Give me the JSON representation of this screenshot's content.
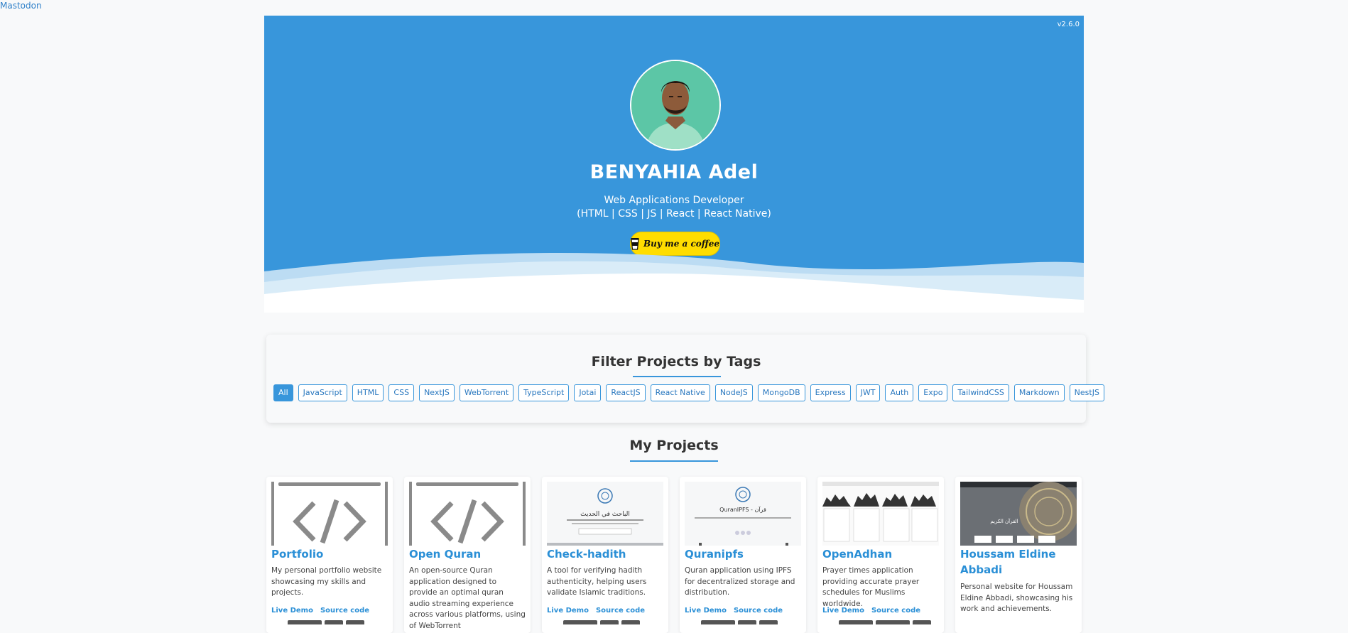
{
  "top_link": "Mastodon",
  "hero": {
    "version": "v2.6.0",
    "name": "BENYAHIA Adel",
    "role_line1": "Web Applications Developer",
    "role_line2": "(HTML | CSS | JS | React | React Native)",
    "coffee_label": "Buy me a coffee",
    "bg_color": "#3896db"
  },
  "filter": {
    "title": "Filter Projects by Tags",
    "tags": [
      "All",
      "JavaScript",
      "HTML",
      "CSS",
      "NextJS",
      "WebTorrent",
      "TypeScript",
      "Jotai",
      "ReactJS",
      "React Native",
      "NodeJS",
      "MongoDB",
      "Express",
      "JWT",
      "Auth",
      "Expo",
      "TailwindCSS",
      "Markdown",
      "NestJS"
    ],
    "active": "All"
  },
  "projects": {
    "title": "My Projects",
    "cards": [
      {
        "title": "Portfolio",
        "desc": "My personal portfolio website showcasing my skills and projects.",
        "live": "Live Demo",
        "source": "Source code",
        "thumb": "code-icon"
      },
      {
        "title": "Open Quran",
        "desc": "An open-source Quran application designed to provide an optimal quran audio streaming experience across various platforms, using of WebTorrent",
        "live": "Live Demo",
        "source": "Source code",
        "thumb": "code-icon"
      },
      {
        "title": "Check-hadith",
        "desc": "A tool for verifying hadith authenticity, helping users validate Islamic traditions.",
        "live": "Live Demo",
        "source": "Source code",
        "thumb": "screenshot-hadith",
        "thumb_text": "الباحث في الحديث"
      },
      {
        "title": "Quranipfs",
        "desc": "Quran application using IPFS for decentralized storage and distribution.",
        "live": "Live Demo",
        "source": "Source code",
        "thumb": "screenshot-quranipfs",
        "thumb_text": "QuranIPFS - قرآن"
      },
      {
        "title": "OpenAdhan",
        "desc": "Prayer times application providing accurate prayer schedules for Muslims worldwide.",
        "live": "Live Demo",
        "source": "Source code",
        "thumb": "screenshot-openadhan"
      },
      {
        "title": "Houssam Eldine Abbadi",
        "desc": "Personal website for Houssam Eldine Abbadi, showcasing his work and achievements.",
        "live": "",
        "source": "",
        "thumb": "screenshot-quran-book",
        "thumb_text": "القرآن الكريم"
      }
    ]
  }
}
